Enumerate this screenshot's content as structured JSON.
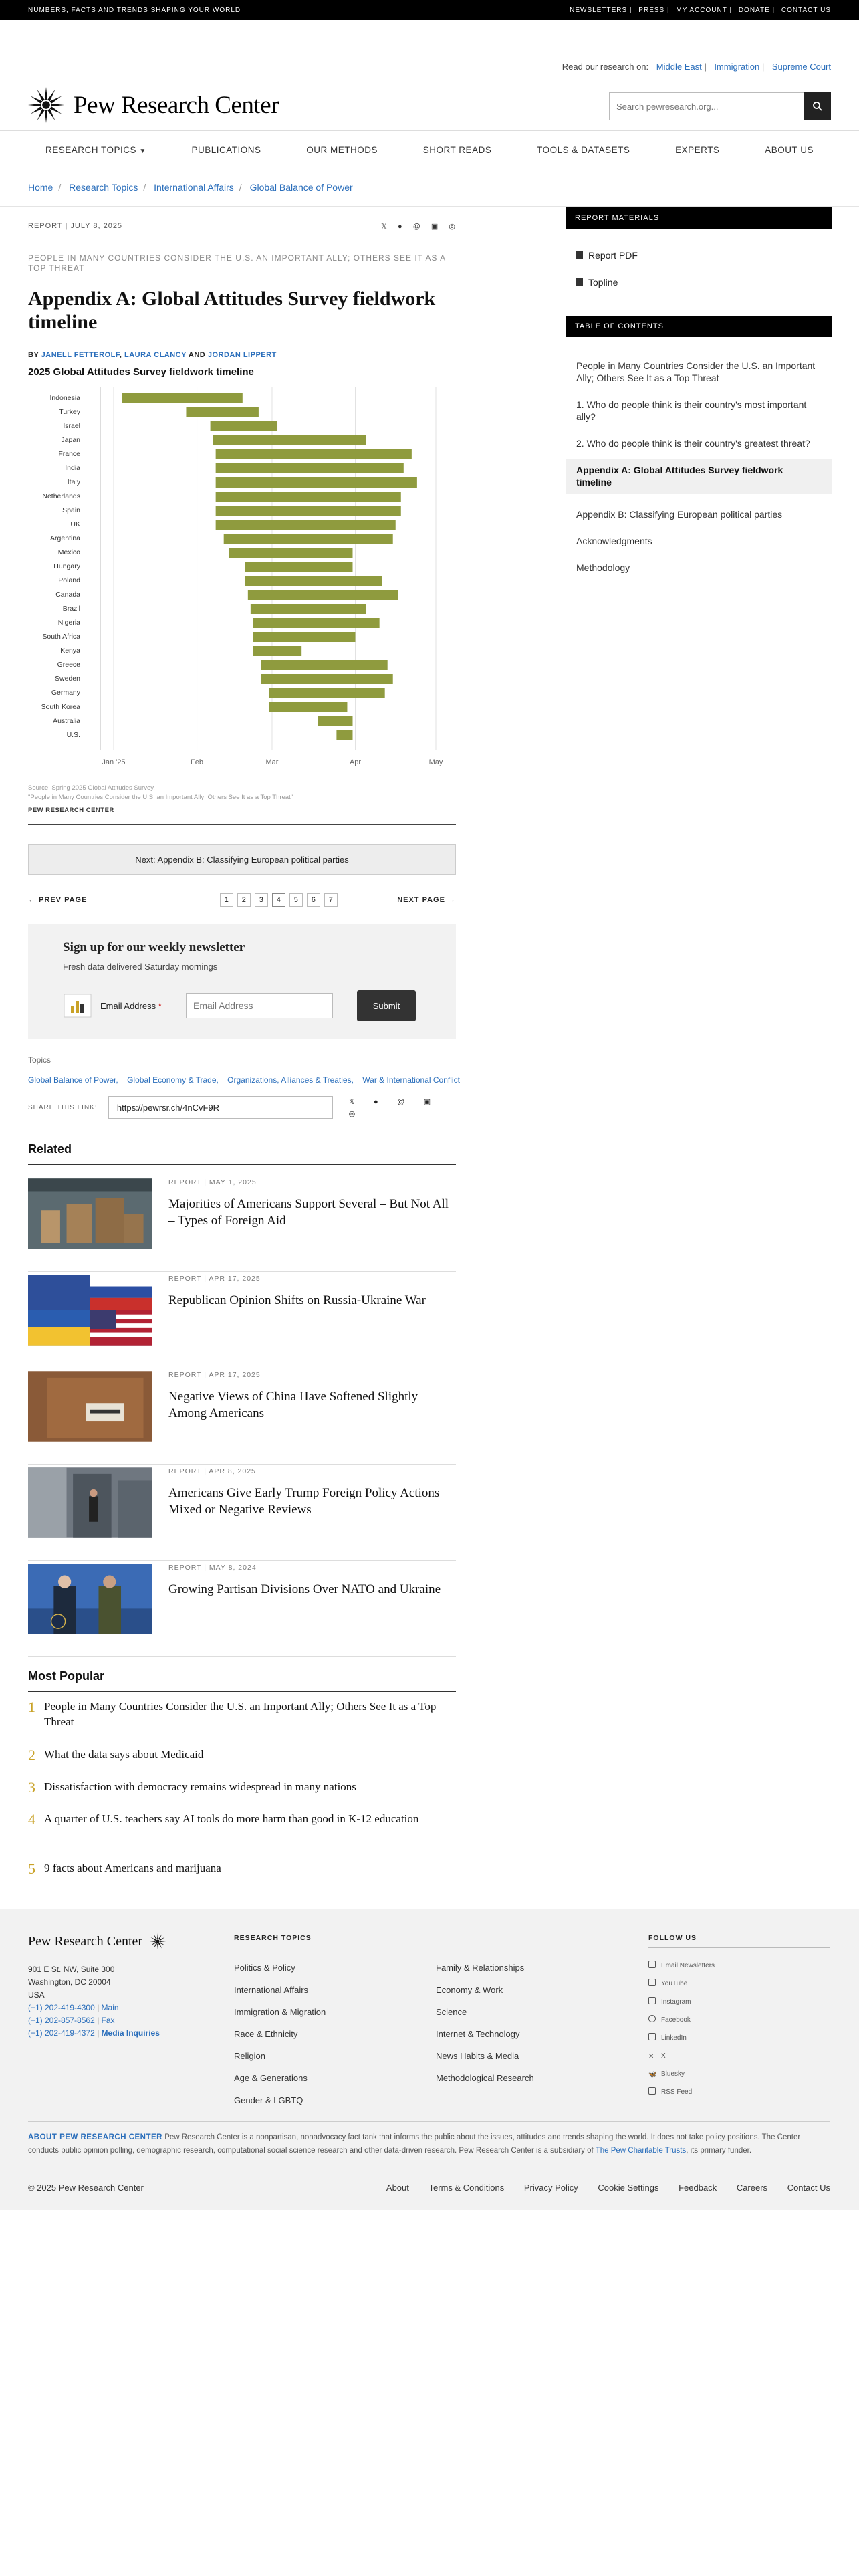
{
  "topbar": {
    "tagline": "NUMBERS, FACTS AND TRENDS SHAPING YOUR WORLD",
    "links": [
      "NEWSLETTERS",
      "PRESS",
      "MY ACCOUNT",
      "DONATE",
      "CONTACT US"
    ]
  },
  "header": {
    "research_on_label": "Read our research on:",
    "research_links": [
      "Middle East",
      "Immigration",
      "Supreme Court"
    ],
    "logo_text": "Pew Research Center",
    "search_placeholder": "Search pewresearch.org..."
  },
  "nav": [
    "RESEARCH TOPICS",
    "PUBLICATIONS",
    "OUR METHODS",
    "SHORT READS",
    "TOOLS & DATASETS",
    "EXPERTS",
    "ABOUT US"
  ],
  "breadcrumb": [
    "Home",
    "Research Topics",
    "International Affairs",
    "Global Balance of Power"
  ],
  "article": {
    "meta": "REPORT | JULY 8, 2025",
    "share_icons": [
      "x-icon",
      "facebook-icon",
      "threads-icon",
      "linkedin-icon",
      "whatsapp-icon"
    ],
    "kicker": "PEOPLE IN MANY COUNTRIES CONSIDER THE U.S. AN IMPORTANT ALLY; OTHERS SEE IT AS A TOP THREAT",
    "title": "Appendix A: Global Attitudes Survey fieldwork timeline",
    "byline_prefix": "BY",
    "authors": [
      "JANELL FETTEROLF",
      "LAURA CLANCY",
      "JORDAN LIPPERT"
    ],
    "byline_sep1": ",",
    "byline_and": "AND"
  },
  "chart_data": {
    "type": "bar",
    "title": "2025 Global Attitudes Survey fieldwork timeline",
    "categories": [
      "Indonesia",
      "Turkey",
      "Israel",
      "Japan",
      "France",
      "India",
      "Italy",
      "Netherlands",
      "Spain",
      "UK",
      "Argentina",
      "Mexico",
      "Hungary",
      "Poland",
      "Canada",
      "Brazil",
      "Nigeria",
      "South Africa",
      "Kenya",
      "Greece",
      "Sweden",
      "Germany",
      "South Korea",
      "Australia",
      "U.S."
    ],
    "series": [
      {
        "values_start": [
          "2025-01-04",
          "2025-01-28",
          "2025-02-06",
          "2025-02-07",
          "2025-02-08",
          "2025-02-08",
          "2025-02-08",
          "2025-02-08",
          "2025-02-08",
          "2025-02-08",
          "2025-02-11",
          "2025-02-13",
          "2025-02-19",
          "2025-02-19",
          "2025-02-20",
          "2025-02-21",
          "2025-02-22",
          "2025-02-22",
          "2025-02-22",
          "2025-02-25",
          "2025-02-25",
          "2025-02-28",
          "2025-02-28",
          "2025-03-18",
          "2025-03-25"
        ],
        "values_end": [
          "2025-02-18",
          "2025-02-24",
          "2025-03-03",
          "2025-04-05",
          "2025-04-22",
          "2025-04-19",
          "2025-04-24",
          "2025-04-18",
          "2025-04-18",
          "2025-04-16",
          "2025-04-15",
          "2025-03-31",
          "2025-03-31",
          "2025-04-11",
          "2025-04-17",
          "2025-04-05",
          "2025-04-10",
          "2025-04-01",
          "2025-03-12",
          "2025-04-13",
          "2025-04-15",
          "2025-04-12",
          "2025-03-29",
          "2025-03-31",
          "2025-03-31"
        ]
      }
    ],
    "x_ticks": [
      "Jan '25",
      "Feb",
      "Mar",
      "Apr",
      "May"
    ],
    "bar_color": "#8f9b3e",
    "note_source": "Source: Spring 2025 Global Attitudes Survey.",
    "note_report": "\"People in Many Countries Consider the U.S. an Important Ally; Others See It as a Top Threat\"",
    "brand": "PEW RESEARCH CENTER"
  },
  "next_box": "Next: Appendix B: Classifying European political parties",
  "pager": {
    "prev": "← PREV PAGE",
    "next": "NEXT PAGE →",
    "pages": [
      "1",
      "2",
      "3",
      "4",
      "5",
      "6",
      "7"
    ],
    "current": "4"
  },
  "newsletter": {
    "title": "Sign up for our weekly newsletter",
    "sub": "Fresh data delivered Saturday mornings",
    "email_label": "Email Address",
    "required_mark": "*",
    "email_placeholder": "Email Address",
    "submit": "Submit"
  },
  "topics": {
    "label": "Topics",
    "items": [
      "Global Balance of Power,",
      "Global Economy & Trade,",
      "Organizations, Alliances & Treaties,",
      "War & International Conflict"
    ]
  },
  "share_link": {
    "label": "SHARE THIS LINK:",
    "url": "https://pewrsr.ch/4nCvF9R"
  },
  "related": {
    "heading": "Related",
    "items": [
      {
        "meta": "REPORT | MAY 1, 2025",
        "title": "Majorities of Americans Support Several – But Not All – Types of Foreign Aid"
      },
      {
        "meta": "REPORT | APR 17, 2025",
        "title": "Republican Opinion Shifts on Russia-Ukraine War"
      },
      {
        "meta": "REPORT | APR 17, 2025",
        "title": "Negative Views of China Have Softened Slightly Among Americans"
      },
      {
        "meta": "REPORT | APR 8, 2025",
        "title": "Americans Give Early Trump Foreign Policy Actions Mixed or Negative Reviews"
      },
      {
        "meta": "REPORT | MAY 8, 2024",
        "title": "Growing Partisan Divisions Over NATO and Ukraine"
      }
    ]
  },
  "popular": {
    "heading": "Most Popular",
    "items": [
      {
        "num": "1",
        "title": "People in Many Countries Consider the U.S. an Important Ally; Others See It as a Top Threat"
      },
      {
        "num": "2",
        "title": "What the data says about Medicaid"
      },
      {
        "num": "3",
        "title": "Dissatisfaction with democracy remains widespread in many nations"
      },
      {
        "num": "4",
        "title": "A quarter of U.S. teachers say AI tools do more harm than good in K-12 education"
      },
      {
        "num": "5",
        "title": "9 facts about Americans and marijuana"
      }
    ]
  },
  "sidebar": {
    "materials_heading": "REPORT MATERIALS",
    "materials": [
      "Report PDF",
      "Topline"
    ],
    "toc_heading": "TABLE OF CONTENTS",
    "toc": [
      "People in Many Countries Consider the U.S. an Important Ally; Others See It as a Top Threat",
      "1. Who do people think is their country's most important ally?",
      "2. Who do people think is their country's greatest threat?",
      "Appendix A: Global Attitudes Survey fieldwork timeline",
      "Appendix B: Classifying European political parties",
      "Acknowledgments",
      "Methodology"
    ],
    "toc_active": 3
  },
  "footer": {
    "logo_text": "Pew Research Center",
    "address": [
      "901 E St. NW, Suite 300",
      "Washington, DC 20004",
      "USA"
    ],
    "phones": [
      {
        "num": "(+1) 202-419-4300",
        "label": "Main"
      },
      {
        "num": "(+1) 202-857-8562",
        "label": "Fax"
      },
      {
        "num": "(+1) 202-419-4372",
        "label": "Media Inquiries"
      }
    ],
    "topics_heading": "RESEARCH TOPICS",
    "topics_col1": [
      "Politics & Policy",
      "International Affairs",
      "Immigration & Migration",
      "Race & Ethnicity",
      "Religion",
      "Age & Generations",
      "Gender & LGBTQ"
    ],
    "topics_col2": [
      "Family & Relationships",
      "Economy & Work",
      "Science",
      "Internet & Technology",
      "News Habits & Media",
      "Methodological Research"
    ],
    "follow_heading": "FOLLOW US",
    "follow": [
      "Email Newsletters",
      "YouTube",
      "Instagram",
      "Facebook",
      "LinkedIn",
      "X",
      "Bluesky",
      "RSS Feed"
    ],
    "about_label": "ABOUT PEW RESEARCH CENTER",
    "about_text": "Pew Research Center is a nonpartisan, nonadvocacy fact tank that informs the public about the issues, attitudes and trends shaping the world. It does not take policy positions. The Center conducts public opinion polling, demographic research, computational social science research and other data-driven research. Pew Research Center is a subsidiary of",
    "about_link": "The Pew Charitable Trusts",
    "about_tail": ", its primary funder.",
    "copyright": "© 2025 Pew Research Center",
    "bottom_links": [
      "About",
      "Terms & Conditions",
      "Privacy Policy",
      "Cookie Settings",
      "Feedback",
      "Careers",
      "Contact Us"
    ]
  }
}
